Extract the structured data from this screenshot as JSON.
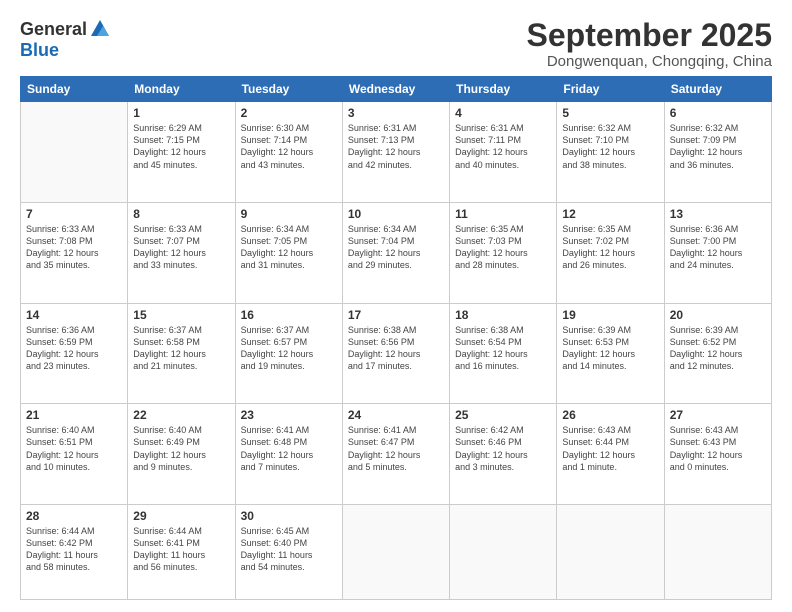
{
  "logo": {
    "general": "General",
    "blue": "Blue"
  },
  "header": {
    "title": "September 2025",
    "subtitle": "Dongwenquan, Chongqing, China"
  },
  "weekdays": [
    "Sunday",
    "Monday",
    "Tuesday",
    "Wednesday",
    "Thursday",
    "Friday",
    "Saturday"
  ],
  "weeks": [
    [
      {
        "day": "",
        "info": ""
      },
      {
        "day": "1",
        "info": "Sunrise: 6:29 AM\nSunset: 7:15 PM\nDaylight: 12 hours\nand 45 minutes."
      },
      {
        "day": "2",
        "info": "Sunrise: 6:30 AM\nSunset: 7:14 PM\nDaylight: 12 hours\nand 43 minutes."
      },
      {
        "day": "3",
        "info": "Sunrise: 6:31 AM\nSunset: 7:13 PM\nDaylight: 12 hours\nand 42 minutes."
      },
      {
        "day": "4",
        "info": "Sunrise: 6:31 AM\nSunset: 7:11 PM\nDaylight: 12 hours\nand 40 minutes."
      },
      {
        "day": "5",
        "info": "Sunrise: 6:32 AM\nSunset: 7:10 PM\nDaylight: 12 hours\nand 38 minutes."
      },
      {
        "day": "6",
        "info": "Sunrise: 6:32 AM\nSunset: 7:09 PM\nDaylight: 12 hours\nand 36 minutes."
      }
    ],
    [
      {
        "day": "7",
        "info": "Sunrise: 6:33 AM\nSunset: 7:08 PM\nDaylight: 12 hours\nand 35 minutes."
      },
      {
        "day": "8",
        "info": "Sunrise: 6:33 AM\nSunset: 7:07 PM\nDaylight: 12 hours\nand 33 minutes."
      },
      {
        "day": "9",
        "info": "Sunrise: 6:34 AM\nSunset: 7:05 PM\nDaylight: 12 hours\nand 31 minutes."
      },
      {
        "day": "10",
        "info": "Sunrise: 6:34 AM\nSunset: 7:04 PM\nDaylight: 12 hours\nand 29 minutes."
      },
      {
        "day": "11",
        "info": "Sunrise: 6:35 AM\nSunset: 7:03 PM\nDaylight: 12 hours\nand 28 minutes."
      },
      {
        "day": "12",
        "info": "Sunrise: 6:35 AM\nSunset: 7:02 PM\nDaylight: 12 hours\nand 26 minutes."
      },
      {
        "day": "13",
        "info": "Sunrise: 6:36 AM\nSunset: 7:00 PM\nDaylight: 12 hours\nand 24 minutes."
      }
    ],
    [
      {
        "day": "14",
        "info": "Sunrise: 6:36 AM\nSunset: 6:59 PM\nDaylight: 12 hours\nand 23 minutes."
      },
      {
        "day": "15",
        "info": "Sunrise: 6:37 AM\nSunset: 6:58 PM\nDaylight: 12 hours\nand 21 minutes."
      },
      {
        "day": "16",
        "info": "Sunrise: 6:37 AM\nSunset: 6:57 PM\nDaylight: 12 hours\nand 19 minutes."
      },
      {
        "day": "17",
        "info": "Sunrise: 6:38 AM\nSunset: 6:56 PM\nDaylight: 12 hours\nand 17 minutes."
      },
      {
        "day": "18",
        "info": "Sunrise: 6:38 AM\nSunset: 6:54 PM\nDaylight: 12 hours\nand 16 minutes."
      },
      {
        "day": "19",
        "info": "Sunrise: 6:39 AM\nSunset: 6:53 PM\nDaylight: 12 hours\nand 14 minutes."
      },
      {
        "day": "20",
        "info": "Sunrise: 6:39 AM\nSunset: 6:52 PM\nDaylight: 12 hours\nand 12 minutes."
      }
    ],
    [
      {
        "day": "21",
        "info": "Sunrise: 6:40 AM\nSunset: 6:51 PM\nDaylight: 12 hours\nand 10 minutes."
      },
      {
        "day": "22",
        "info": "Sunrise: 6:40 AM\nSunset: 6:49 PM\nDaylight: 12 hours\nand 9 minutes."
      },
      {
        "day": "23",
        "info": "Sunrise: 6:41 AM\nSunset: 6:48 PM\nDaylight: 12 hours\nand 7 minutes."
      },
      {
        "day": "24",
        "info": "Sunrise: 6:41 AM\nSunset: 6:47 PM\nDaylight: 12 hours\nand 5 minutes."
      },
      {
        "day": "25",
        "info": "Sunrise: 6:42 AM\nSunset: 6:46 PM\nDaylight: 12 hours\nand 3 minutes."
      },
      {
        "day": "26",
        "info": "Sunrise: 6:43 AM\nSunset: 6:44 PM\nDaylight: 12 hours\nand 1 minute."
      },
      {
        "day": "27",
        "info": "Sunrise: 6:43 AM\nSunset: 6:43 PM\nDaylight: 12 hours\nand 0 minutes."
      }
    ],
    [
      {
        "day": "28",
        "info": "Sunrise: 6:44 AM\nSunset: 6:42 PM\nDaylight: 11 hours\nand 58 minutes."
      },
      {
        "day": "29",
        "info": "Sunrise: 6:44 AM\nSunset: 6:41 PM\nDaylight: 11 hours\nand 56 minutes."
      },
      {
        "day": "30",
        "info": "Sunrise: 6:45 AM\nSunset: 6:40 PM\nDaylight: 11 hours\nand 54 minutes."
      },
      {
        "day": "",
        "info": ""
      },
      {
        "day": "",
        "info": ""
      },
      {
        "day": "",
        "info": ""
      },
      {
        "day": "",
        "info": ""
      }
    ]
  ]
}
